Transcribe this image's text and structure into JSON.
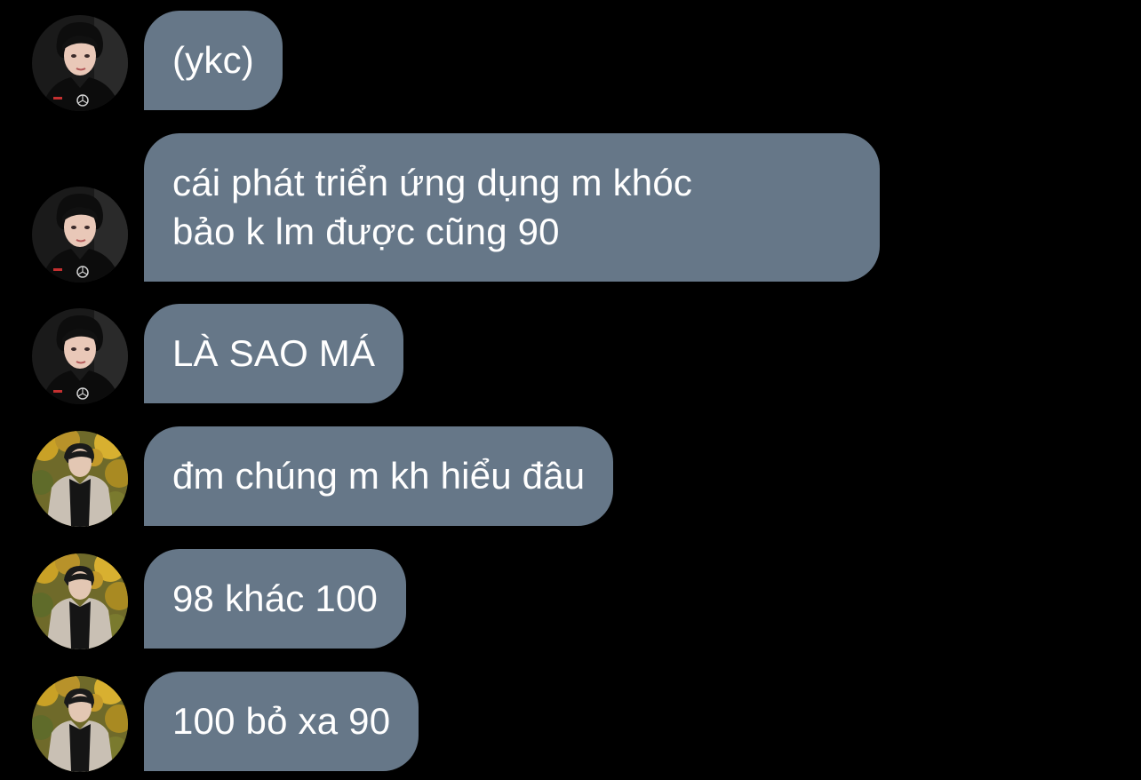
{
  "messages": [
    {
      "sender": "user-a",
      "avatar_icon": "avatar-dark-shirt-icon",
      "text": "(ykc)"
    },
    {
      "sender": "user-a",
      "avatar_icon": "avatar-dark-shirt-icon",
      "text": "cái phát triển ứng dụng m khóc\nbảo k lm được cũng 90"
    },
    {
      "sender": "user-a",
      "avatar_icon": "avatar-dark-shirt-icon",
      "text": "LÀ SAO MÁ"
    },
    {
      "sender": "user-b",
      "avatar_icon": "avatar-autumn-trees-icon",
      "text": "đm chúng m kh hiểu đâu"
    },
    {
      "sender": "user-b",
      "avatar_icon": "avatar-autumn-trees-icon",
      "text": "98 khác 100"
    },
    {
      "sender": "user-b",
      "avatar_icon": "avatar-autumn-trees-icon",
      "text": "100 bỏ xa 90"
    }
  ],
  "colors": {
    "background": "#000000",
    "bubble": "#667788",
    "bubble_text": "#ffffff"
  }
}
